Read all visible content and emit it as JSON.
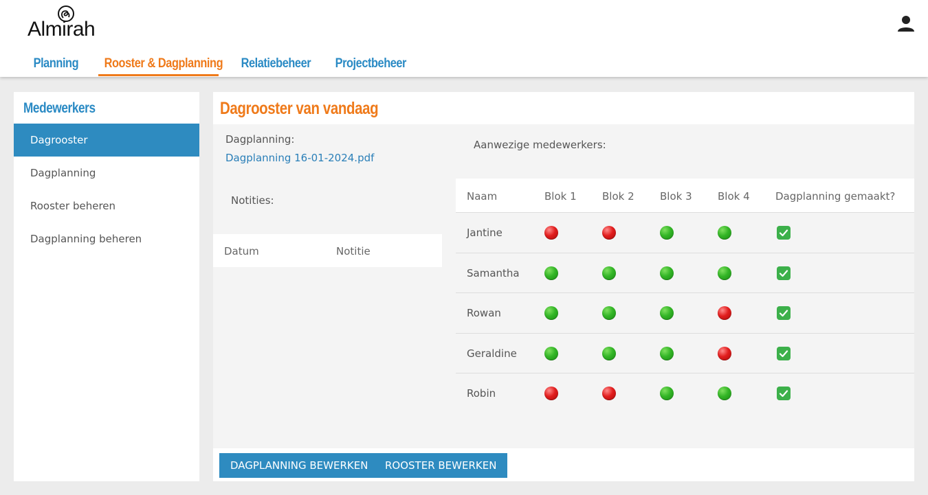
{
  "header": {
    "logo_text": "Almirah",
    "nav": [
      {
        "label": "Planning",
        "active": false
      },
      {
        "label": "Rooster & Dagplanning",
        "active": true
      },
      {
        "label": "Relatiebeheer",
        "active": false
      },
      {
        "label": "Projectbeheer",
        "active": false
      }
    ],
    "user_icon": "user-icon"
  },
  "sidebar": {
    "title": "Medewerkers",
    "items": [
      {
        "label": "Dagrooster",
        "active": true
      },
      {
        "label": "Dagplanning",
        "active": false
      },
      {
        "label": "Rooster beheren",
        "active": false
      },
      {
        "label": "Dagplanning beheren",
        "active": false
      }
    ]
  },
  "main": {
    "title": "Dagrooster van vandaag",
    "dagplanning_label": "Dagplanning:",
    "dagplanning_file": "Dagplanning 16-01-2024.pdf",
    "notities_label": "Notities:",
    "notes_columns": [
      "Datum",
      "Notitie"
    ],
    "aanwezig_label": "Aanwezige medewerkers:",
    "staff_columns": [
      "Naam",
      "Blok 1",
      "Blok 2",
      "Blok 3",
      "Blok 4",
      "Dagplanning gemaakt?"
    ],
    "staff": [
      {
        "name": "Jantine",
        "blocks": [
          "red",
          "red",
          "green",
          "green"
        ],
        "done": true
      },
      {
        "name": "Samantha",
        "blocks": [
          "green",
          "green",
          "green",
          "green"
        ],
        "done": true
      },
      {
        "name": "Rowan",
        "blocks": [
          "green",
          "green",
          "green",
          "red"
        ],
        "done": true
      },
      {
        "name": "Geraldine",
        "blocks": [
          "green",
          "green",
          "green",
          "red"
        ],
        "done": true
      },
      {
        "name": "Robin",
        "blocks": [
          "red",
          "red",
          "green",
          "green"
        ],
        "done": true
      }
    ],
    "buttons": {
      "edit_planning": "DAGPLANNING BEWERKEN",
      "edit_rooster": "ROOSTER BEWERKEN"
    }
  },
  "colors": {
    "accent_blue": "#2e8bc0",
    "accent_orange": "#ef7a1a",
    "status_green": "#33b526",
    "status_red": "#e11d1d"
  }
}
